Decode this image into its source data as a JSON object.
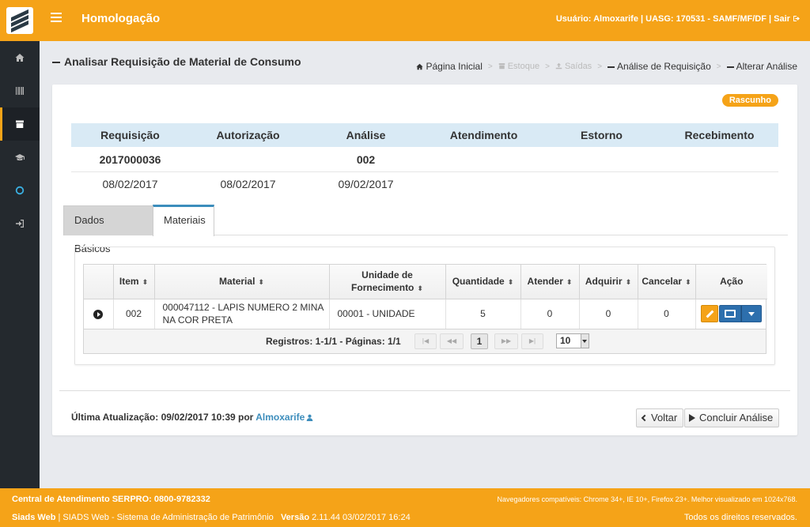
{
  "header": {
    "title": "Homologação",
    "user_info": "Usuário: Almoxarife | UASG: 170531 - SAMF/MF/DF |",
    "logout_label": "Sair"
  },
  "sidebar": {
    "items": [
      {
        "icon": "home-icon"
      },
      {
        "icon": "barcode-icon"
      },
      {
        "icon": "archive-icon",
        "active": true
      },
      {
        "icon": "graduation-cap-icon"
      },
      {
        "icon": "circle-icon"
      },
      {
        "icon": "sign-in-icon"
      }
    ]
  },
  "page": {
    "title": "Analisar Requisição de Material de Consumo",
    "breadcrumb": [
      "Página Inicial",
      "Estoque",
      "Saídas",
      "Análise de Requisição",
      "Alterar Análise"
    ]
  },
  "status_badge": "Rascunho",
  "flow": {
    "headers": [
      "Requisição",
      "Autorização",
      "Análise",
      "Atendimento",
      "Estorno",
      "Recebimento"
    ],
    "numbers": [
      "2017000036",
      "",
      "002",
      "",
      "",
      ""
    ],
    "dates": [
      "08/02/2017",
      "08/02/2017",
      "09/02/2017",
      "",
      "",
      ""
    ]
  },
  "tabs": [
    "Dados Básicos",
    "Materiais"
  ],
  "grid": {
    "columns": [
      "",
      "Item",
      "Material",
      "Unidade de Fornecimento",
      "Quantidade",
      "Atender",
      "Adquirir",
      "Cancelar",
      "Ação"
    ],
    "rows": [
      {
        "item": "002",
        "material": "000047112 - LAPIS NUMERO 2 MINA NA COR PRETA",
        "unidade": "00001 - UNIDADE",
        "quantidade": "5",
        "atender": "0",
        "adquirir": "0",
        "cancelar": "0"
      }
    ],
    "pager": {
      "info": "Registros: 1-1/1 - Páginas: 1/1",
      "current_page": "1",
      "page_size": "10"
    }
  },
  "footer_card": {
    "last_update_label": "Última Atualização: 09/02/2017 10:39 por",
    "last_update_user": "Almoxarife",
    "back_label": "Voltar",
    "finish_label": "Concluir Análise"
  },
  "footer": {
    "support": "Central de Atendimento SERPRO: 0800-9782332",
    "browsers": "Navegadores compatíveis: Chrome 34+, IE 10+, Firefox 23+. Melhor visualizado em 1024x768.",
    "system_name": "Siads Web",
    "system_desc": "| SIADS Web - Sistema de Administração de Patrimônio",
    "version_label": "Versão",
    "version": "2.11.44 03/02/2017 16:24",
    "rights": "Todos os direitos reservados."
  },
  "colors": {
    "brand": "#f5a318",
    "sidebar": "#24292e",
    "accent_blue": "#3c8dbc"
  }
}
